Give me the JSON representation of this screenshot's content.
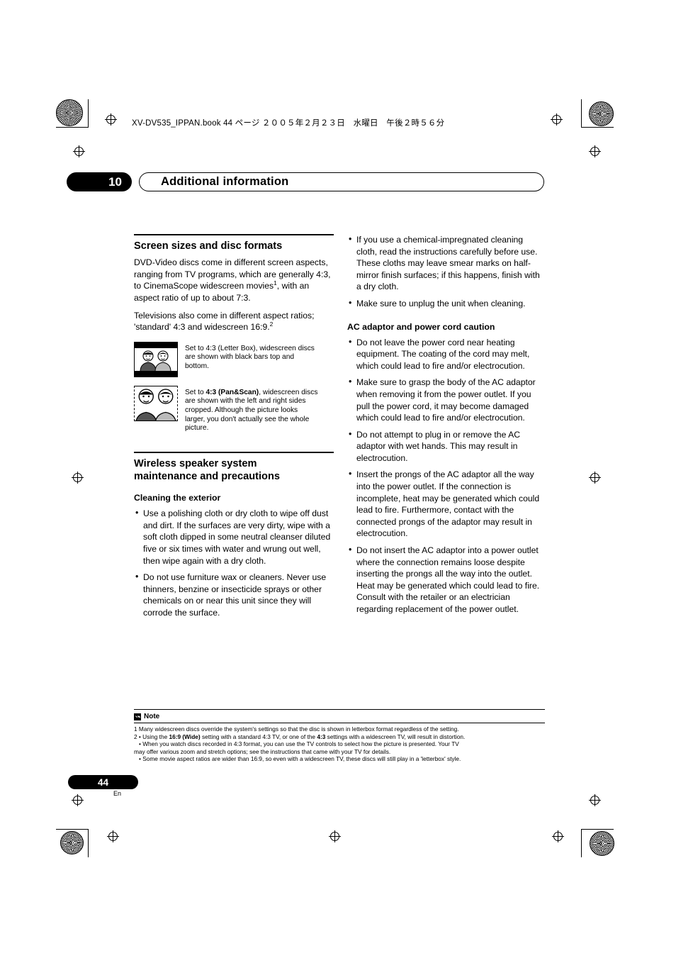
{
  "header": {
    "filename_line": "XV-DV535_IPPAN.book 44 ページ ２００５年２月２３日　水曜日　午後２時５６分"
  },
  "chapter": {
    "number": "10",
    "title": "Additional information"
  },
  "left_column": {
    "screen_sizes": {
      "heading": "Screen sizes and disc formats",
      "paragraph1_pre": "DVD-Video discs come in different screen aspects, ranging from TV programs, which are generally 4:3, to CinemaScope widescreen movies",
      "paragraph1_sup": "1",
      "paragraph1_post": ", with an aspect ratio of up to about 7:3.",
      "paragraph2_pre": "Televisions also come in different aspect ratios; 'standard' 4:3 and widescreen 16:9.",
      "paragraph2_sup": "2",
      "figure1_caption_pre": "Set to 4:3 (Letter Box), widescreen discs are shown with black bars top and bottom.",
      "figure2_caption_pre": "Set to ",
      "figure2_caption_bold": "4:3 (Pan&Scan)",
      "figure2_caption_post": ", widescreen discs are shown with the left and right sides cropped. Although the picture looks larger, you don't actually see the whole picture."
    },
    "wireless": {
      "heading_line1": "Wireless speaker system",
      "heading_line2": "maintenance and precautions",
      "cleaning_head": "Cleaning the exterior",
      "bullets": [
        "Use a polishing cloth or dry cloth to wipe off dust and dirt. If the surfaces are very dirty, wipe with a soft cloth dipped in some neutral cleanser diluted five or six times with water and wrung out well, then wipe again with a dry cloth.",
        "Do not use furniture wax or cleaners. Never use thinners, benzine or insecticide sprays or other chemicals on or near this unit since they will corrode the surface."
      ]
    }
  },
  "right_column": {
    "cleaning_continued_bullets": [
      "If you use a chemical-impregnated cleaning cloth, read the instructions carefully before use. These cloths may leave smear marks on half-mirror finish surfaces; if this happens, finish with a dry cloth.",
      "Make sure to unplug the unit when cleaning."
    ],
    "ac_adaptor": {
      "heading": "AC adaptor and power cord caution",
      "bullets": [
        "Do not leave the power cord near heating equipment. The coating of the cord may melt, which could lead to fire and/or electrocution.",
        "Make sure to grasp the body of the AC adaptor when removing it from the power outlet. If you pull the power cord, it may become damaged which could lead to fire and/or electrocution.",
        "Do not attempt to plug in or remove the AC adaptor with wet hands. This may result in electrocution.",
        "Insert the prongs of the AC adaptor all the way into the power outlet. If the connection is incomplete, heat may be generated which could lead to fire. Furthermore, contact with the connected prongs of the adaptor may result in electrocution.",
        "Do not insert the AC adaptor into a power outlet where the connection remains loose despite inserting the prongs all the way into the outlet. Heat may be generated which could lead to fire. Consult with the retailer or an electrician regarding replacement of the power outlet."
      ]
    }
  },
  "note": {
    "label": "Note",
    "line1": "1 Many widescreen discs override the system's settings so that the disc is shown in letterbox format regardless of the setting.",
    "line2_a": "2 • Using the ",
    "line2_b": "16:9 (Wide)",
    "line2_c": " setting with a standard 4:3 TV, or one of the ",
    "line2_d": "4:3",
    "line2_e": " settings with a widescreen TV, will result in distortion.",
    "line3": "• When you watch discs recorded in 4:3 format, you can use the TV controls to select how the picture is presented. Your TV",
    "line4": "may offer various zoom and stretch options; see the instructions that came with your TV for details.",
    "line5": "• Some movie aspect ratios are wider than 16:9, so even with a widescreen TV, these discs will still play in a 'letterbox' style."
  },
  "footer": {
    "page_number": "44",
    "language": "En"
  }
}
